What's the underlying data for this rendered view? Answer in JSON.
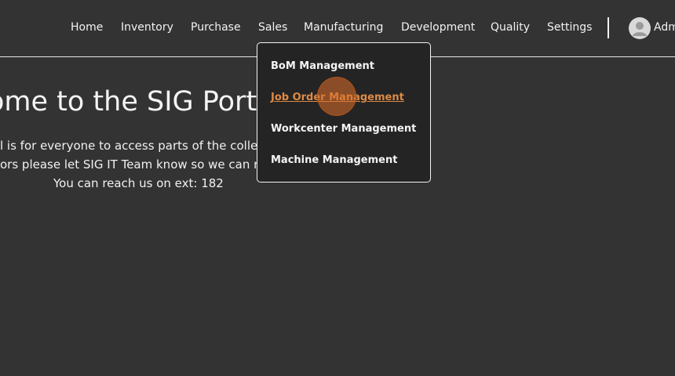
{
  "navbar": {
    "items": [
      {
        "label": "Home"
      },
      {
        "label": "Inventory"
      },
      {
        "label": "Purchase"
      },
      {
        "label": "Sales"
      },
      {
        "label": "Manufacturing"
      },
      {
        "label": "Development"
      },
      {
        "label": "Quality"
      },
      {
        "label": "Settings"
      }
    ],
    "user": {
      "name": "Adm",
      "avatar_icon": "user-avatar-icon"
    }
  },
  "hero": {
    "title": "ome to the SIG Porta",
    "line1": "l is for everyone to access parts of the collec",
    "line2": "ors please let SIG IT Team know so we can re",
    "line3": "You can reach us on ext: 182"
  },
  "dropdown": {
    "items": [
      {
        "label": "BoM Management"
      },
      {
        "label": "Job Order Management"
      },
      {
        "label": "Workcenter Management"
      },
      {
        "label": "Machine Management"
      }
    ],
    "active_index": 1
  },
  "colors": {
    "background": "#333333",
    "dropdown_bg": "#242424",
    "accent": "#de8a43",
    "text": "#f2f2f2"
  }
}
